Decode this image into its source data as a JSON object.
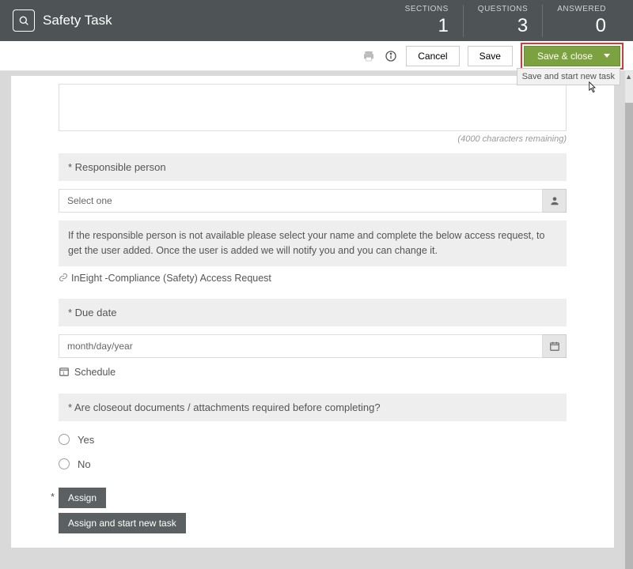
{
  "header": {
    "title": "Safety Task",
    "stats": {
      "sections_label": "SECTIONS",
      "sections_value": "1",
      "questions_label": "QUESTIONS",
      "questions_value": "3",
      "answered_label": "ANSWERED",
      "answered_value": "0"
    }
  },
  "toolbar": {
    "cancel": "Cancel",
    "save": "Save",
    "save_close": "Save & close",
    "dropdown_item": "Save and start new task"
  },
  "textarea": {
    "remaining": "(4000 characters remaining)"
  },
  "responsible": {
    "label": "* Responsible person",
    "placeholder": "Select one",
    "info": "If the responsible person is not available please select your name and complete the below access request, to get the user added. Once the user is added we will notify you and you can change it.",
    "link": "InEight -Compliance (Safety) Access Request"
  },
  "duedate": {
    "label": "* Due date",
    "placeholder": "month/day/year",
    "schedule": "Schedule"
  },
  "closeout": {
    "label": "* Are closeout documents / attachments required before completing?",
    "yes": "Yes",
    "no": "No"
  },
  "assign": {
    "btn1": "Assign",
    "btn2": "Assign and start new task"
  }
}
